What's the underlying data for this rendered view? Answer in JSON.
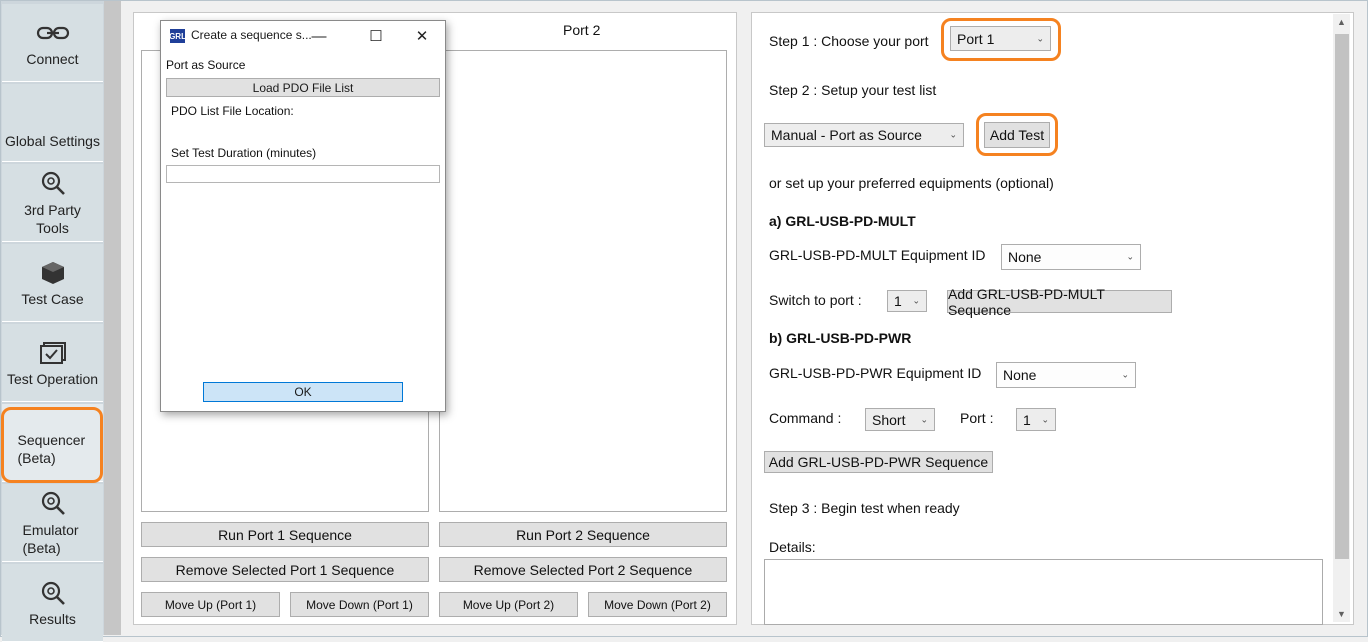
{
  "sidebar": {
    "items": [
      {
        "label": "Connect",
        "icon": "link-icon"
      },
      {
        "label": "Global Settings",
        "icon": "none"
      },
      {
        "label": "3rd Party Tools",
        "icon": "magnifier-gear-icon"
      },
      {
        "label": "Test Case",
        "icon": "cube-icon"
      },
      {
        "label": "Test Operation",
        "icon": "checklist-icon"
      },
      {
        "label": "Sequencer (Beta)",
        "icon": "none"
      },
      {
        "label": "Emulator (Beta)",
        "icon": "magnifier-gear-icon"
      },
      {
        "label": "Results",
        "icon": "magnifier-gear-icon"
      }
    ],
    "highlight_color": "#f58220"
  },
  "ports": {
    "port2_title": "Port 2",
    "run_port1": "Run Port 1 Sequence",
    "run_port2": "Run Port 2 Sequence",
    "remove_port1": "Remove Selected Port 1 Sequence",
    "remove_port2": "Remove Selected Port 2 Sequence",
    "move_up_port1": "Move Up (Port 1)",
    "move_down_port1": "Move Down (Port 1)",
    "move_up_port2": "Move Up (Port 2)",
    "move_down_port2": "Move Down (Port 2)"
  },
  "dialog": {
    "title": "Create a sequence s...",
    "logo_text": "GRL",
    "subtitle": "Port as Source",
    "load_button": "Load PDO File List",
    "file_location_label": "PDO List File Location:",
    "duration_label": "Set Test Duration (minutes)",
    "duration_value": "",
    "ok_label": "OK",
    "minimize": "—",
    "maximize": "☐",
    "close": "✕"
  },
  "setup": {
    "step1_label": "Step 1 : Choose your port",
    "port_select": "Port 1",
    "step2_label": "Step 2 : Setup your test list",
    "test_type_select": "Manual - Port as Source",
    "add_test_label": "Add Test",
    "optional_label": "or set up your preferred equipments (optional)",
    "mult_heading": "a) GRL-USB-PD-MULT",
    "mult_equipment_label": "GRL-USB-PD-MULT Equipment ID",
    "mult_equipment_select": "None",
    "switch_port_label": "Switch to port :",
    "switch_port_select": "1",
    "add_mult_seq": "Add GRL-USB-PD-MULT Sequence",
    "pwr_heading": "b) GRL-USB-PD-PWR",
    "pwr_equipment_label": "GRL-USB-PD-PWR Equipment ID",
    "pwr_equipment_select": "None",
    "command_label": "Command :",
    "command_select": "Short",
    "port_label": "Port :",
    "port_num_select": "1",
    "add_pwr_seq": "Add GRL-USB-PD-PWR Sequence",
    "step3_label": "Step 3 : Begin test when ready",
    "details_label": "Details:",
    "details_value": ""
  }
}
